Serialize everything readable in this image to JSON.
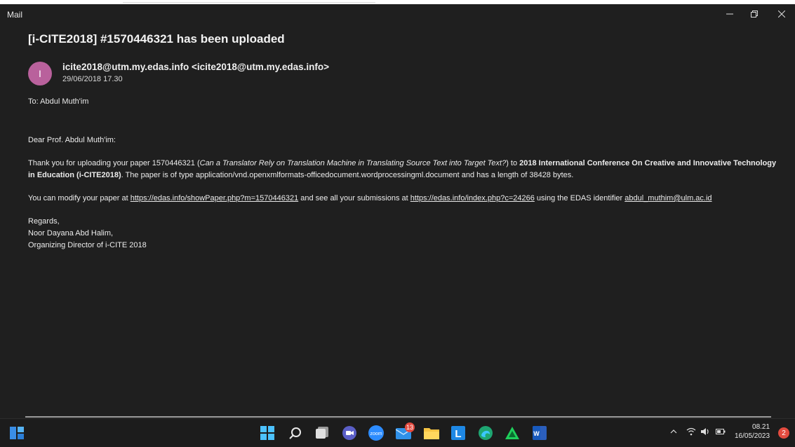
{
  "window": {
    "app_title": "Mail"
  },
  "email": {
    "subject": "[i-CITE2018] #1570446321 has been uploaded",
    "avatar_initial": "I",
    "sender": "icite2018@utm.my.edas.info <icite2018@utm.my.edas.info>",
    "date": "29/06/2018 17.30",
    "recipient": "To: Abdul Muth'im",
    "greeting": "Dear Prof. Abdul Muth'im:",
    "p1_intro": "Thank you for uploading your paper 1570446321 (",
    "p1_paper_title": "Can a Translator Rely on Translation Machine in Translating Source Text into Target Text?",
    "p1_to": ") to ",
    "p1_conference": "2018 International Conference On Creative and Innovative Technology in Education (i-CITE2018)",
    "p1_rest": ". The paper is of type application/vnd.openxmlformats-officedocument.wordprocessingml.document and has a length of 38428 bytes.",
    "p2_intro": "You can modify your paper at ",
    "p2_link1": "https://edas.info/showPaper.php?m=1570446321",
    "p2_mid": " and see all your submissions at ",
    "p2_link2": "https://edas.info/index.php?c=24266",
    "p2_mid2": " using the EDAS identifier ",
    "p2_link3": "abdul_muthim@ulm.ac.id",
    "regards": "Regards,",
    "signer": "Noor Dayana Abd Halim,",
    "signer_title": "Organizing Director of i-CITE 2018"
  },
  "taskbar": {
    "mail_badge": "13",
    "zoom_label": "zoom",
    "l_label": "L",
    "word_label": "W",
    "clock_time": "08.21",
    "clock_date": "16/05/2023",
    "notification_count": "2"
  },
  "colors": {
    "window_bg": "#1f1f1f",
    "avatar": "#b9619c",
    "badge": "#e34b3f"
  }
}
